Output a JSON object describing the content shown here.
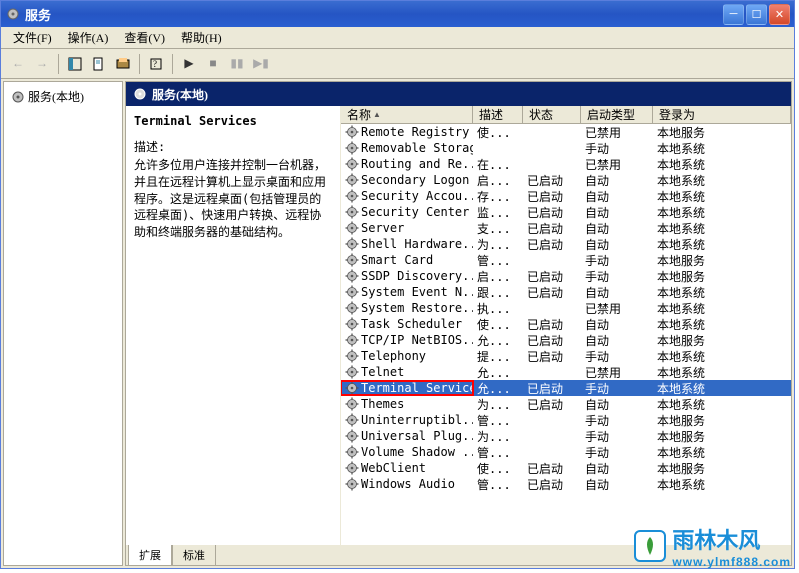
{
  "window": {
    "title": "服务"
  },
  "menu": {
    "file": "文件(F)",
    "action": "操作(A)",
    "view": "查看(V)",
    "help": "帮助(H)"
  },
  "tree": {
    "root": "服务(本地)"
  },
  "panel": {
    "header": "服务(本地)"
  },
  "detail": {
    "title": "Terminal Services",
    "desc_label": "描述:",
    "desc_text": "允许多位用户连接并控制一台机器，并且在远程计算机上显示桌面和应用程序。这是远程桌面(包括管理员的远程桌面)、快速用户转换、远程协助和终端服务器的基础结构。"
  },
  "columns": {
    "name": "名称",
    "desc": "描述",
    "status": "状态",
    "startup": "启动类型",
    "logon": "登录为"
  },
  "services": [
    {
      "name": "Remote Registry",
      "desc": "使...",
      "status": "",
      "startup": "已禁用",
      "logon": "本地服务",
      "sel": false
    },
    {
      "name": "Removable Storage",
      "desc": "",
      "status": "",
      "startup": "手动",
      "logon": "本地系统",
      "sel": false
    },
    {
      "name": "Routing and Re...",
      "desc": "在...",
      "status": "",
      "startup": "已禁用",
      "logon": "本地系统",
      "sel": false
    },
    {
      "name": "Secondary Logon",
      "desc": "启...",
      "status": "已启动",
      "startup": "自动",
      "logon": "本地系统",
      "sel": false
    },
    {
      "name": "Security Accou...",
      "desc": "存...",
      "status": "已启动",
      "startup": "自动",
      "logon": "本地系统",
      "sel": false
    },
    {
      "name": "Security Center",
      "desc": "监...",
      "status": "已启动",
      "startup": "自动",
      "logon": "本地系统",
      "sel": false
    },
    {
      "name": "Server",
      "desc": "支...",
      "status": "已启动",
      "startup": "自动",
      "logon": "本地系统",
      "sel": false
    },
    {
      "name": "Shell Hardware...",
      "desc": "为...",
      "status": "已启动",
      "startup": "自动",
      "logon": "本地系统",
      "sel": false
    },
    {
      "name": "Smart Card",
      "desc": "管...",
      "status": "",
      "startup": "手动",
      "logon": "本地服务",
      "sel": false
    },
    {
      "name": "SSDP Discovery...",
      "desc": "启...",
      "status": "已启动",
      "startup": "手动",
      "logon": "本地服务",
      "sel": false
    },
    {
      "name": "System Event N...",
      "desc": "跟...",
      "status": "已启动",
      "startup": "自动",
      "logon": "本地系统",
      "sel": false
    },
    {
      "name": "System Restore...",
      "desc": "执...",
      "status": "",
      "startup": "已禁用",
      "logon": "本地系统",
      "sel": false
    },
    {
      "name": "Task Scheduler",
      "desc": "使...",
      "status": "已启动",
      "startup": "自动",
      "logon": "本地系统",
      "sel": false
    },
    {
      "name": "TCP/IP NetBIOS...",
      "desc": "允...",
      "status": "已启动",
      "startup": "自动",
      "logon": "本地服务",
      "sel": false
    },
    {
      "name": "Telephony",
      "desc": "提...",
      "status": "已启动",
      "startup": "手动",
      "logon": "本地系统",
      "sel": false
    },
    {
      "name": "Telnet",
      "desc": "允...",
      "status": "",
      "startup": "已禁用",
      "logon": "本地系统",
      "sel": false
    },
    {
      "name": "Terminal Services",
      "desc": "允...",
      "status": "已启动",
      "startup": "手动",
      "logon": "本地系统",
      "sel": true
    },
    {
      "name": "Themes",
      "desc": "为...",
      "status": "已启动",
      "startup": "自动",
      "logon": "本地系统",
      "sel": false
    },
    {
      "name": "Uninterruptibl...",
      "desc": "管...",
      "status": "",
      "startup": "手动",
      "logon": "本地服务",
      "sel": false
    },
    {
      "name": "Universal Plug...",
      "desc": "为...",
      "status": "",
      "startup": "手动",
      "logon": "本地服务",
      "sel": false
    },
    {
      "name": "Volume Shadow ...",
      "desc": "管...",
      "status": "",
      "startup": "手动",
      "logon": "本地系统",
      "sel": false
    },
    {
      "name": "WebClient",
      "desc": "使...",
      "status": "已启动",
      "startup": "自动",
      "logon": "本地服务",
      "sel": false
    },
    {
      "name": "Windows Audio",
      "desc": "管...",
      "status": "已启动",
      "startup": "自动",
      "logon": "本地系统",
      "sel": false
    }
  ],
  "tabs": {
    "extended": "扩展",
    "standard": "标准"
  },
  "watermark": {
    "brand": "雨林木风",
    "url": "www.ylmf888.com"
  }
}
